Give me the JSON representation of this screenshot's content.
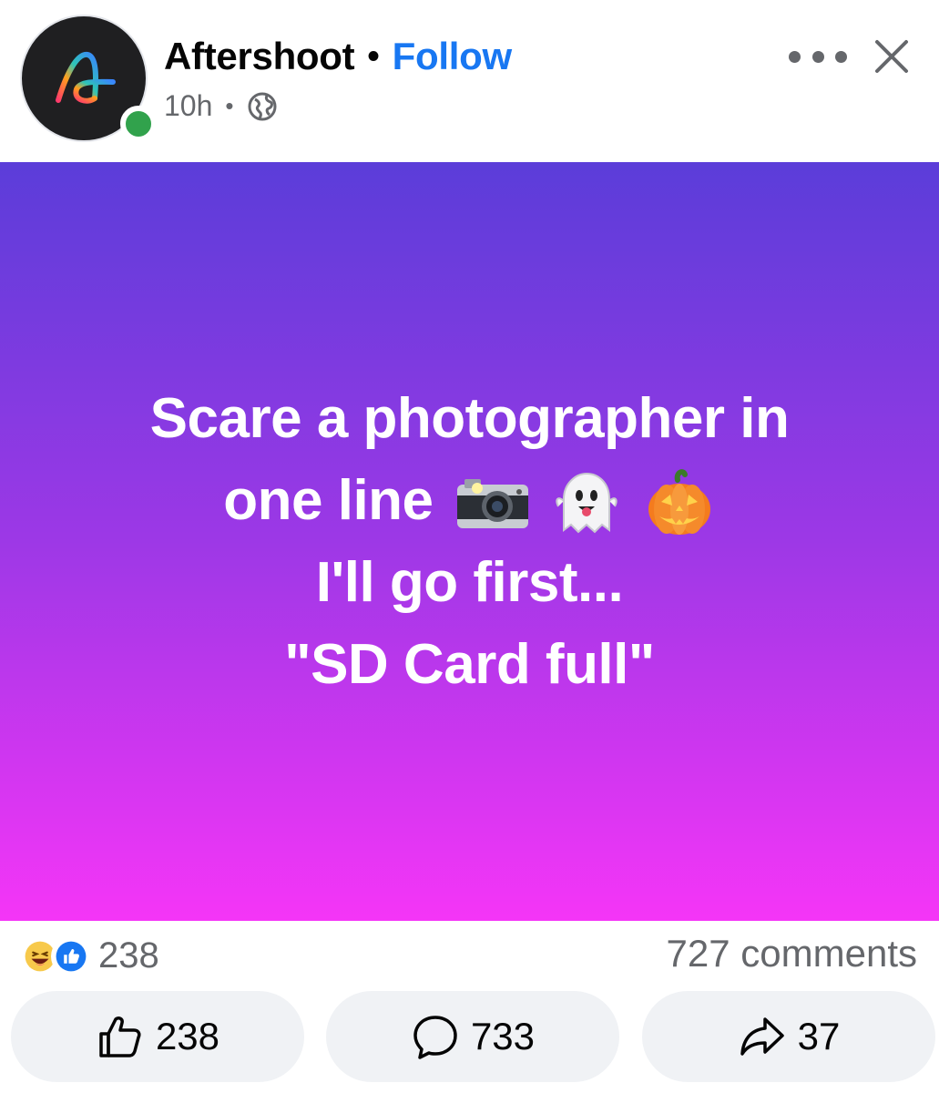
{
  "header": {
    "page_name": "Aftershoot",
    "separator": "•",
    "follow_label": "Follow",
    "time": "10h",
    "meta_separator": "•",
    "audience_icon": "globe-icon",
    "more_icon": "more-horizontal-icon",
    "close_icon": "close-icon"
  },
  "post": {
    "line1": "Scare a photographer in",
    "line2": "one line",
    "line2_emojis": [
      "camera-with-flash-emoji",
      "ghost-emoji",
      "jack-o-lantern-emoji"
    ],
    "line3": "I'll go first...",
    "line4": "\"SD Card full\"",
    "gradient_top": "#5b3dd9",
    "gradient_bottom": "#f535f7"
  },
  "stats": {
    "reaction_icons": [
      "haha-reaction-icon",
      "like-reaction-icon"
    ],
    "reaction_count": "238",
    "comments_label": "727 comments"
  },
  "actions": {
    "like_count": "238",
    "comment_count": "733",
    "share_count": "37"
  },
  "colors": {
    "accent": "#1877f2",
    "online": "#31a24c",
    "muted_text": "#65676b",
    "pill_bg": "#f0f2f5"
  }
}
